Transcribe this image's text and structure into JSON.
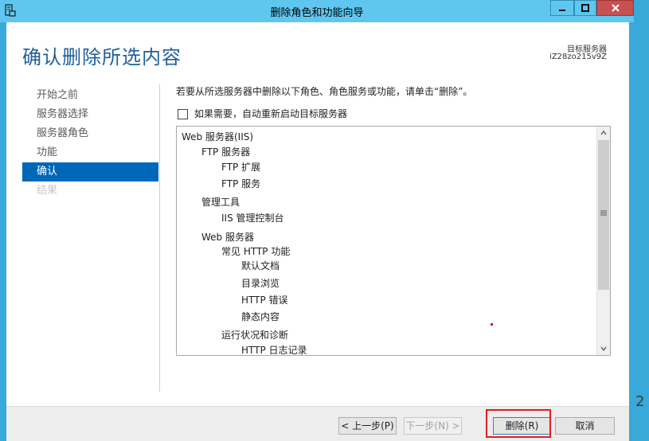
{
  "window": {
    "title": "删除角色和功能向导"
  },
  "header": {
    "page_title": "确认删除所选内容",
    "target_server_label": "目标服务器",
    "target_server_name": "iZ28zo215v9Z"
  },
  "nav": {
    "items": [
      {
        "label": "开始之前",
        "state": "normal"
      },
      {
        "label": "服务器选择",
        "state": "normal"
      },
      {
        "label": "服务器角色",
        "state": "normal"
      },
      {
        "label": "功能",
        "state": "normal"
      },
      {
        "label": "确认",
        "state": "active"
      },
      {
        "label": "结果",
        "state": "disabled"
      }
    ]
  },
  "main": {
    "instruction": "若要从所选服务器中删除以下角色、角色服务或功能，请单击“删除”。",
    "restart_checkbox": {
      "label": "如果需要，自动重新启动目标服务器",
      "checked": false
    },
    "tree": [
      {
        "label": "Web 服务器(IIS)",
        "level": 0
      },
      {
        "label": "FTP 服务器",
        "level": 1
      },
      {
        "label": "FTP 扩展",
        "level": 2
      },
      {
        "label": "FTP 服务",
        "level": 2
      },
      {
        "label": "管理工具",
        "level": 1
      },
      {
        "label": "IIS 管理控制台",
        "level": 2
      },
      {
        "label": "Web 服务器",
        "level": 1
      },
      {
        "label": "常见 HTTP 功能",
        "level": 2
      },
      {
        "label": "默认文档",
        "level": 3
      },
      {
        "label": "目录浏览",
        "level": 3
      },
      {
        "label": "HTTP 错误",
        "level": 3
      },
      {
        "label": "静态内容",
        "level": 3
      },
      {
        "label": "运行状况和诊断",
        "level": 2
      },
      {
        "label": "HTTP 日志记录",
        "level": 3
      }
    ]
  },
  "footer": {
    "prev_label": "< 上一步(P)",
    "next_label": "下一步(N) >",
    "remove_label": "删除(R)",
    "cancel_label": "取消"
  },
  "edge_glyph": "2",
  "colors": {
    "accent": "#0067b8",
    "title_bar": "#5fc7ef",
    "page_title": "#1e5f9a",
    "highlight": "#e02020"
  }
}
